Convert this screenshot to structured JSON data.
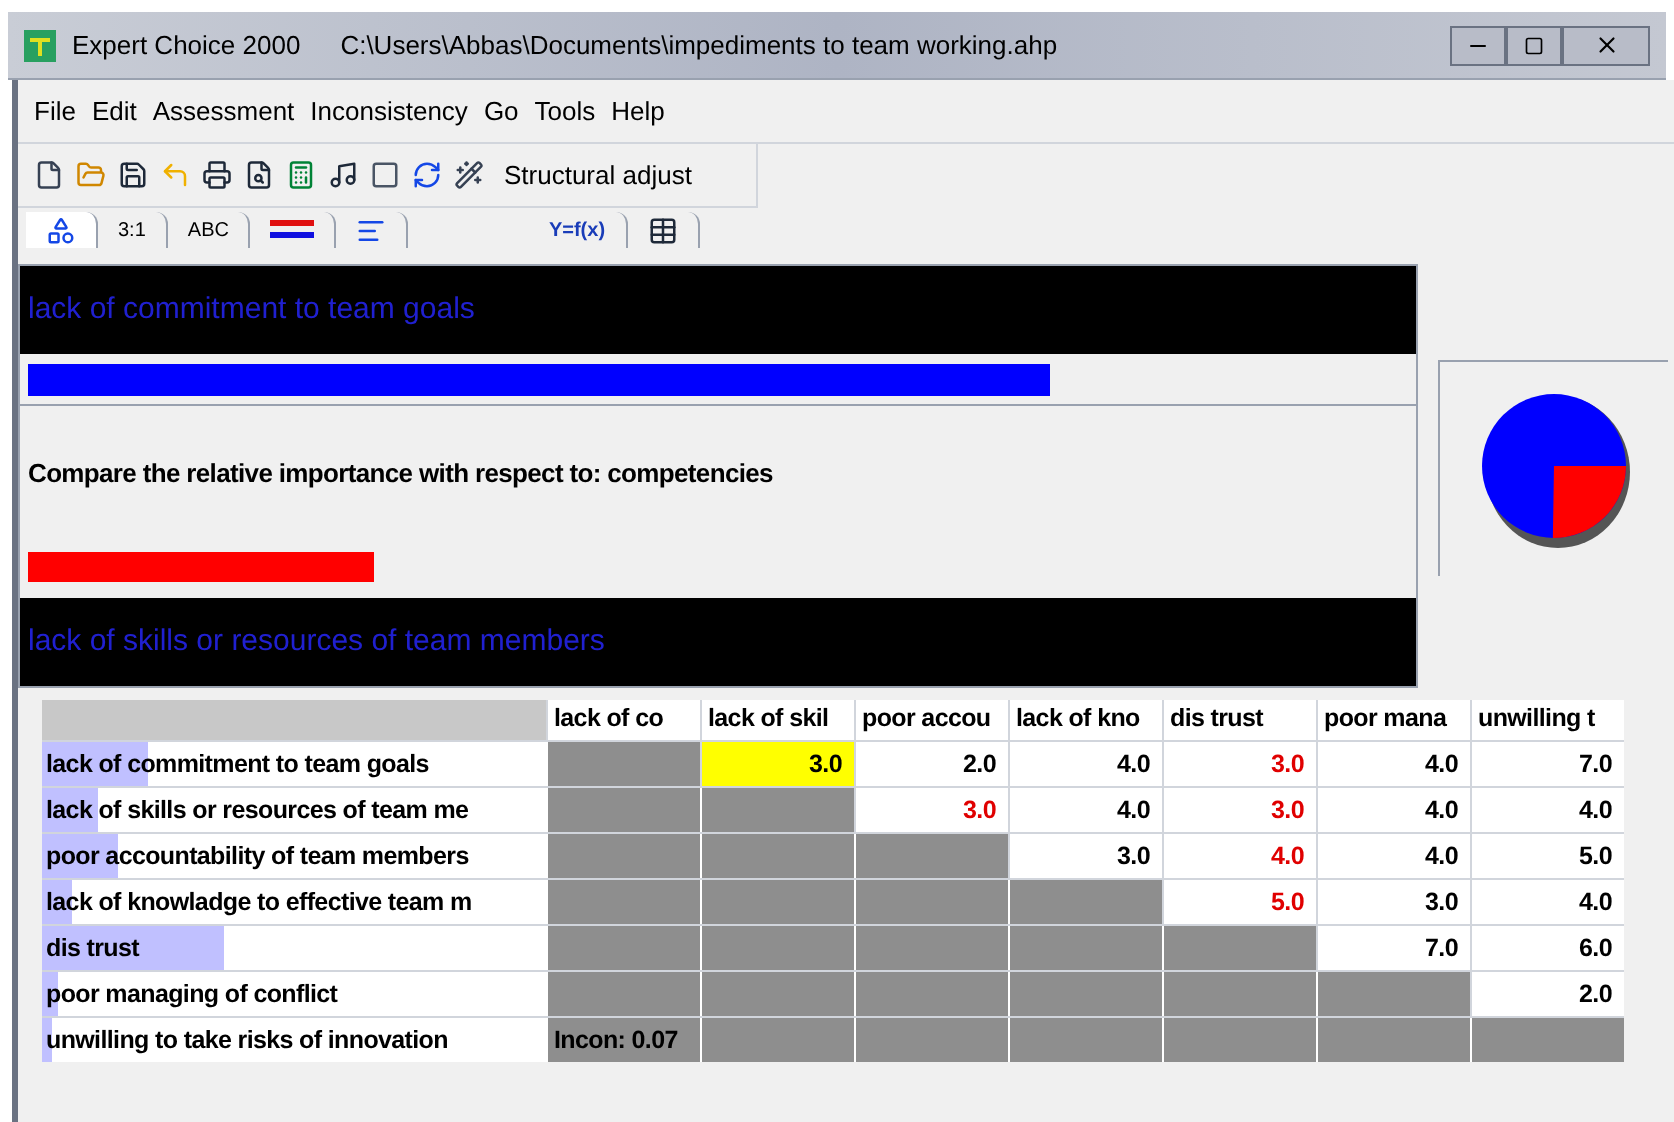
{
  "window": {
    "title": "Expert Choice 2000",
    "path": "C:\\Users\\Abbas\\Documents\\impediments to team working.ahp"
  },
  "menu": [
    "File",
    "Edit",
    "Assessment",
    "Inconsistency",
    "Go",
    "Tools",
    "Help"
  ],
  "toolbar": {
    "button": "Structural adjust"
  },
  "tabs": [
    {
      "kind": "icon",
      "selected": true
    },
    {
      "kind": "text",
      "label": "3:1",
      "selected": false
    },
    {
      "kind": "text",
      "label": "ABC",
      "selected": false
    },
    {
      "kind": "icon",
      "selected": false
    },
    {
      "kind": "icon",
      "selected": false
    },
    {
      "kind": "text",
      "label": "Y=f(x)",
      "selected": false
    },
    {
      "kind": "icon",
      "selected": false
    }
  ],
  "comparison": {
    "element_a": "lack of commitment to team goals",
    "priority_a": {
      "level": 0.74
    },
    "prompt": "Compare the relative importance  with respect to: competencies",
    "priority_b": {
      "level": 0.25
    },
    "element_b": "lack of skills or resources of team members"
  },
  "matrix": {
    "columns": [
      "lack of co",
      "lack of skil",
      "poor accou",
      "lack of kno",
      "dis trust",
      "poor mana",
      "unwilling t"
    ],
    "rows": [
      {
        "label": "lack of commitment to team goals",
        "level": 0.21,
        "cells": [
          {
            "kind": "blank"
          },
          {
            "kind": "value",
            "text": "3.0",
            "inverted": false,
            "selected": true
          },
          {
            "kind": "value",
            "text": "2.0",
            "inverted": false,
            "selected": false
          },
          {
            "kind": "value",
            "text": "4.0",
            "inverted": false,
            "selected": false
          },
          {
            "kind": "value",
            "text": "3.0",
            "inverted": true,
            "selected": false
          },
          {
            "kind": "value",
            "text": "4.0",
            "inverted": false,
            "selected": false
          },
          {
            "kind": "value",
            "text": "7.0",
            "inverted": false,
            "selected": false
          }
        ]
      },
      {
        "label": "lack of skills or resources of team me",
        "level": 0.11,
        "cells": [
          {
            "kind": "blank"
          },
          {
            "kind": "blank"
          },
          {
            "kind": "value",
            "text": "3.0",
            "inverted": true,
            "selected": false
          },
          {
            "kind": "value",
            "text": "4.0",
            "inverted": false,
            "selected": false
          },
          {
            "kind": "value",
            "text": "3.0",
            "inverted": true,
            "selected": false
          },
          {
            "kind": "value",
            "text": "4.0",
            "inverted": false,
            "selected": false
          },
          {
            "kind": "value",
            "text": "4.0",
            "inverted": false,
            "selected": false
          }
        ]
      },
      {
        "label": "poor accountability of team members",
        "level": 0.15,
        "cells": [
          {
            "kind": "blank"
          },
          {
            "kind": "blank"
          },
          {
            "kind": "blank"
          },
          {
            "kind": "value",
            "text": "3.0",
            "inverted": false,
            "selected": false
          },
          {
            "kind": "value",
            "text": "4.0",
            "inverted": true,
            "selected": false
          },
          {
            "kind": "value",
            "text": "4.0",
            "inverted": false,
            "selected": false
          },
          {
            "kind": "value",
            "text": "5.0",
            "inverted": false,
            "selected": false
          }
        ]
      },
      {
        "label": "lack of knowladge to effective team m",
        "level": 0.06,
        "cells": [
          {
            "kind": "blank"
          },
          {
            "kind": "blank"
          },
          {
            "kind": "blank"
          },
          {
            "kind": "blank"
          },
          {
            "kind": "value",
            "text": "5.0",
            "inverted": true,
            "selected": false
          },
          {
            "kind": "value",
            "text": "3.0",
            "inverted": false,
            "selected": false
          },
          {
            "kind": "value",
            "text": "4.0",
            "inverted": false,
            "selected": false
          }
        ]
      },
      {
        "label": "dis trust",
        "level": 0.36,
        "cells": [
          {
            "kind": "blank"
          },
          {
            "kind": "blank"
          },
          {
            "kind": "blank"
          },
          {
            "kind": "blank"
          },
          {
            "kind": "blank"
          },
          {
            "kind": "value",
            "text": "7.0",
            "inverted": false,
            "selected": false
          },
          {
            "kind": "value",
            "text": "6.0",
            "inverted": false,
            "selected": false
          }
        ]
      },
      {
        "label": "poor managing of conflict",
        "level": 0.03,
        "cells": [
          {
            "kind": "blank"
          },
          {
            "kind": "blank"
          },
          {
            "kind": "blank"
          },
          {
            "kind": "blank"
          },
          {
            "kind": "blank"
          },
          {
            "kind": "blank"
          },
          {
            "kind": "value",
            "text": "2.0",
            "inverted": false,
            "selected": false
          }
        ]
      },
      {
        "label": "unwilling to take risks of innovation",
        "level": 0.02,
        "cells": [
          {
            "kind": "note",
            "text": "Incon: 0.07"
          },
          {
            "kind": "blank"
          },
          {
            "kind": "blank"
          },
          {
            "kind": "blank"
          },
          {
            "kind": "blank"
          },
          {
            "kind": "blank"
          },
          {
            "kind": "blank"
          }
        ]
      }
    ]
  }
}
